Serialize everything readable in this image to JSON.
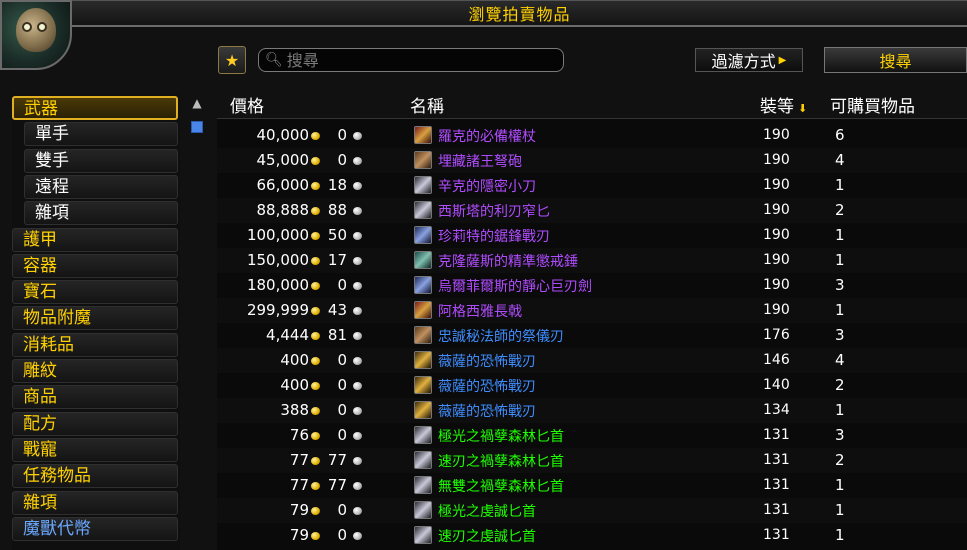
{
  "window": {
    "title": "瀏覽拍賣物品"
  },
  "search": {
    "placeholder": "搜尋",
    "value": ""
  },
  "toolbar": {
    "filter_label": "過濾方式",
    "search_label": "搜尋"
  },
  "categories": [
    {
      "label": "武器",
      "level": 0,
      "selected": true
    },
    {
      "label": "單手",
      "level": 1
    },
    {
      "label": "雙手",
      "level": 1
    },
    {
      "label": "遠程",
      "level": 1
    },
    {
      "label": "雜項",
      "level": 1
    },
    {
      "label": "護甲",
      "level": 0
    },
    {
      "label": "容器",
      "level": 0
    },
    {
      "label": "寶石",
      "level": 0
    },
    {
      "label": "物品附魔",
      "level": 0
    },
    {
      "label": "消耗品",
      "level": 0
    },
    {
      "label": "雕紋",
      "level": 0
    },
    {
      "label": "商品",
      "level": 0
    },
    {
      "label": "配方",
      "level": 0
    },
    {
      "label": "戰寵",
      "level": 0
    },
    {
      "label": "任務物品",
      "level": 0
    },
    {
      "label": "雜項",
      "level": 0
    },
    {
      "label": "魔獸代幣",
      "level": 0,
      "color": "blue"
    }
  ],
  "columns": {
    "price": "價格",
    "name": "名稱",
    "ilvl": "裝等",
    "qty": "可購買物品"
  },
  "colors": {
    "epic": "#b04cff",
    "rare": "#3f8dff",
    "uncommon": "#1eff00",
    "accent": "#ffd100"
  },
  "rows": [
    {
      "gold": "40,000",
      "silver": "0",
      "icon": "staff-icon",
      "quality": "epic",
      "name": "羅克的必備權杖",
      "ilvl": "190",
      "qty": "6"
    },
    {
      "gold": "45,000",
      "silver": "0",
      "icon": "crossbow-icon",
      "quality": "epic",
      "name": "埋藏諸王弩砲",
      "ilvl": "190",
      "qty": "4"
    },
    {
      "gold": "66,000",
      "silver": "18",
      "icon": "dagger-icon",
      "quality": "epic",
      "name": "辛克的隱密小刀",
      "ilvl": "190",
      "qty": "1"
    },
    {
      "gold": "88,888",
      "silver": "88",
      "icon": "dagger-icon",
      "quality": "epic",
      "name": "西斯塔的利刃窄匕",
      "ilvl": "190",
      "qty": "2"
    },
    {
      "gold": "100,000",
      "silver": "50",
      "icon": "sword-icon",
      "quality": "epic",
      "name": "珍莉特的鋸鋒戰刃",
      "ilvl": "190",
      "qty": "1"
    },
    {
      "gold": "150,000",
      "silver": "17",
      "icon": "mace-icon",
      "quality": "epic",
      "name": "克隆薩斯的精準懲戒錘",
      "ilvl": "190",
      "qty": "1"
    },
    {
      "gold": "180,000",
      "silver": "0",
      "icon": "greatsword-icon",
      "quality": "epic",
      "name": "烏爾菲爾斯的靜心巨刃劍",
      "ilvl": "190",
      "qty": "3"
    },
    {
      "gold": "299,999",
      "silver": "43",
      "icon": "polearm-icon",
      "quality": "epic",
      "name": "阿格西雅長戟",
      "ilvl": "190",
      "qty": "1"
    },
    {
      "gold": "4,444",
      "silver": "81",
      "icon": "ritual-blade-icon",
      "quality": "rare",
      "name": "忠誠秘法師的祭儀刃",
      "ilvl": "176",
      "qty": "3"
    },
    {
      "gold": "400",
      "silver": "0",
      "icon": "warblade-icon",
      "quality": "rare",
      "name": "薇薩的恐怖戰刃",
      "ilvl": "146",
      "qty": "4"
    },
    {
      "gold": "400",
      "silver": "0",
      "icon": "warblade-icon",
      "quality": "rare",
      "name": "薇薩的恐怖戰刃",
      "ilvl": "140",
      "qty": "2"
    },
    {
      "gold": "388",
      "silver": "0",
      "icon": "warblade-icon",
      "quality": "rare",
      "name": "薇薩的恐怖戰刃",
      "ilvl": "134",
      "qty": "1"
    },
    {
      "gold": "76",
      "silver": "0",
      "icon": "dagger-icon",
      "quality": "uncommon",
      "name": "極光之禍孽森林匕首",
      "ilvl": "131",
      "qty": "3"
    },
    {
      "gold": "77",
      "silver": "77",
      "icon": "dagger-icon",
      "quality": "uncommon",
      "name": "速刃之禍孽森林匕首",
      "ilvl": "131",
      "qty": "2"
    },
    {
      "gold": "77",
      "silver": "77",
      "icon": "dagger-icon",
      "quality": "uncommon",
      "name": "無雙之禍孽森林匕首",
      "ilvl": "131",
      "qty": "1"
    },
    {
      "gold": "79",
      "silver": "0",
      "icon": "dagger-icon",
      "quality": "uncommon",
      "name": "極光之虔誠匕首",
      "ilvl": "131",
      "qty": "1"
    },
    {
      "gold": "79",
      "silver": "0",
      "icon": "dagger-icon",
      "quality": "uncommon",
      "name": "速刃之虔誠匕首",
      "ilvl": "131",
      "qty": "1"
    }
  ]
}
